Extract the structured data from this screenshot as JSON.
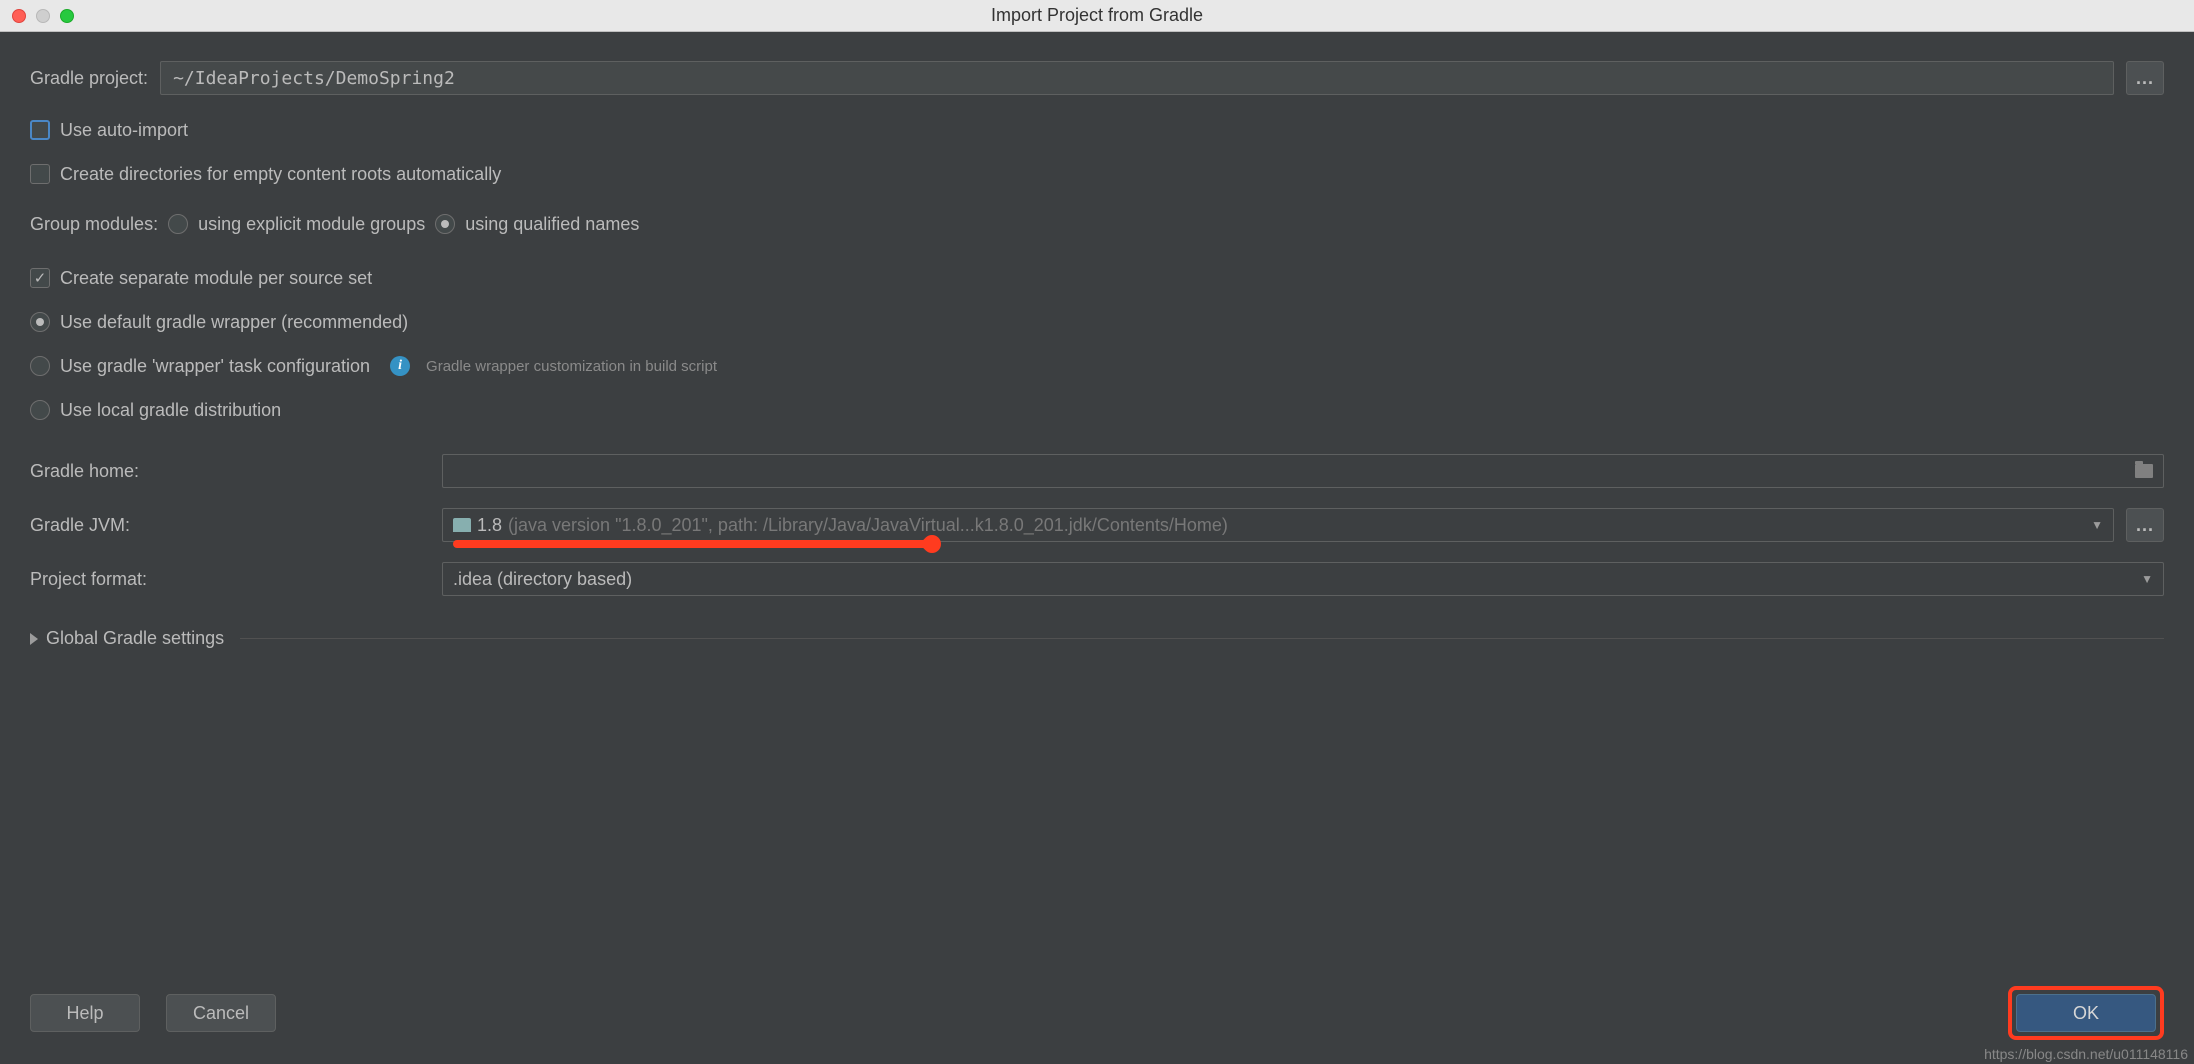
{
  "window": {
    "title": "Import Project from Gradle"
  },
  "fields": {
    "gradle_project_label": "Gradle project:",
    "gradle_project_value": "~/IdeaProjects/DemoSpring2",
    "gradle_home_label": "Gradle home:",
    "gradle_home_value": "",
    "gradle_jvm_label": "Gradle JVM:",
    "gradle_jvm_version": "1.8",
    "gradle_jvm_detail": "(java version \"1.8.0_201\", path: /Library/Java/JavaVirtual...k1.8.0_201.jdk/Contents/Home)",
    "project_format_label": "Project format:",
    "project_format_value": ".idea (directory based)"
  },
  "checkboxes": {
    "auto_import": "Use auto-import",
    "create_dirs": "Create directories for empty content roots automatically",
    "separate_module": "Create separate module per source set"
  },
  "group_modules": {
    "label": "Group modules:",
    "opt_explicit": "using explicit module groups",
    "opt_qualified": "using qualified names"
  },
  "wrapper": {
    "default": "Use default gradle wrapper (recommended)",
    "task": "Use gradle 'wrapper' task configuration",
    "task_hint": "Gradle wrapper customization in build script",
    "local": "Use local gradle distribution"
  },
  "disclosure": {
    "label": "Global Gradle settings"
  },
  "buttons": {
    "help": "Help",
    "cancel": "Cancel",
    "ok": "OK"
  },
  "watermark": "https://blog.csdn.net/u011148116"
}
